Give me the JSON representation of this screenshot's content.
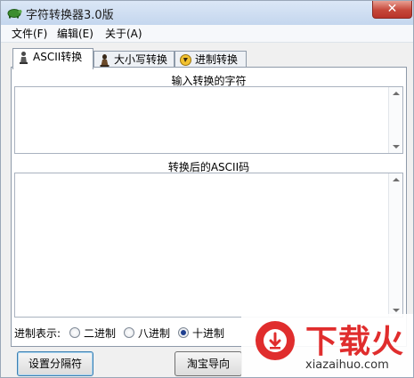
{
  "window": {
    "title": "字符转换器3.0版",
    "close_glyph": "✕"
  },
  "menu": [
    "文件(F)",
    "编辑(E)",
    "关于(A)"
  ],
  "tabs": [
    {
      "label": "ASCII转换",
      "active": true
    },
    {
      "label": "大小写转换",
      "active": false
    },
    {
      "label": "进制转换",
      "active": false
    }
  ],
  "input_section": {
    "label": "输入转换的字符",
    "value": ""
  },
  "output_section": {
    "label": "转换后的ASCII码",
    "value": ""
  },
  "radix": {
    "title": "进制表示:",
    "options": [
      {
        "label": "二进制",
        "checked": false
      },
      {
        "label": "八进制",
        "checked": false
      },
      {
        "label": "十进制",
        "checked": true
      }
    ]
  },
  "buttons": {
    "separator": "设置分隔符",
    "taobao": "淘宝导向"
  },
  "watermark": {
    "text": "下载火",
    "sub": "xiazaihuo.com"
  },
  "colors": {
    "accent_red": "#e02d2d",
    "titlebar": "#c4d6ee"
  }
}
